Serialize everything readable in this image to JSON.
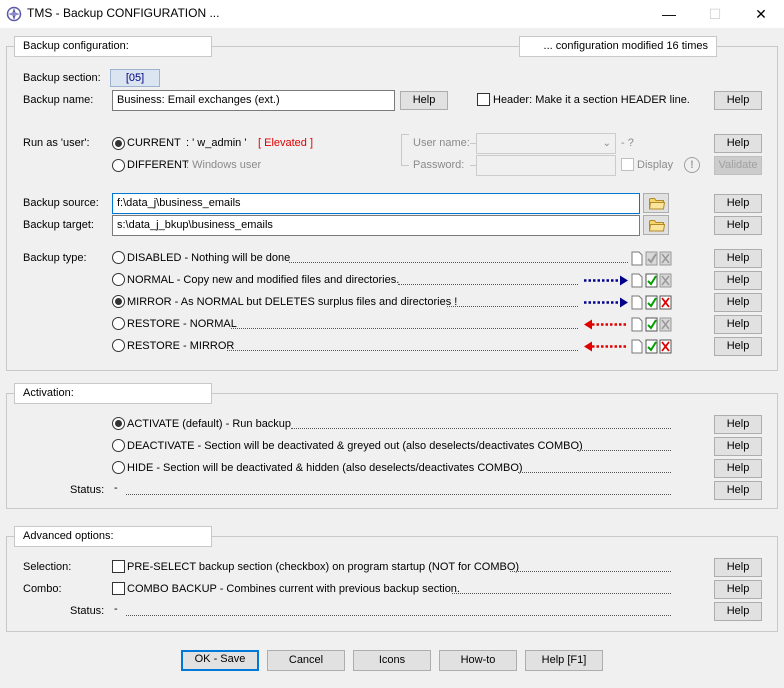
{
  "window": {
    "title": "TMS - Backup CONFIGURATION ...",
    "minimize_glyph": "—",
    "maximize_glyph": "☐",
    "close_glyph": "✕"
  },
  "backup_config": {
    "group_title": "Backup configuration:",
    "modified_text": "... configuration modified 16 times",
    "section_label": "Backup section:",
    "section_value": "[05]",
    "name_label": "Backup name:",
    "name_value": "Business: Email exchanges (ext.)",
    "header_checkbox_label": "Header: Make it a section HEADER line.",
    "run_as_label": "Run as 'user':",
    "current_label": "CURRENT",
    "current_user": ": ' w_admin '",
    "elevated": "[ Elevated ]",
    "different_label": "DIFFERENT",
    "windows_user": ": Windows user",
    "username_label": "User name:",
    "username_hint": "- ?",
    "password_label": "Password:",
    "display_label": "Display",
    "info_glyph": "!",
    "validate_label": "Validate",
    "source_label": "Backup source:",
    "source_value": "f:\\data_j\\business_emails",
    "target_label": "Backup target:",
    "target_value": "s:\\data_j_bkup\\business_emails",
    "type_label": "Backup type:",
    "types": [
      {
        "label": "DISABLED - Nothing will be done",
        "selected": false
      },
      {
        "label": "NORMAL - Copy new and modified files and directories.",
        "selected": false
      },
      {
        "label": "MIRROR - As NORMAL but DELETES surplus files and directories !",
        "selected": true
      },
      {
        "label": "RESTORE - NORMAL",
        "selected": false
      },
      {
        "label": "RESTORE - MIRROR",
        "selected": false
      }
    ]
  },
  "activation": {
    "group_title": "Activation:",
    "options": [
      {
        "label": "ACTIVATE (default) - Run backup",
        "selected": true
      },
      {
        "label": "DEACTIVATE - Section will be deactivated & greyed out (also deselects/deactivates COMBO)",
        "selected": false
      },
      {
        "label": "HIDE - Section will be deactivated & hidden (also deselects/deactivates COMBO)",
        "selected": false
      }
    ],
    "status_label": "Status:",
    "status_value": "-"
  },
  "advanced": {
    "group_title": "Advanced options:",
    "selection_label": "Selection:",
    "selection_text": "PRE-SELECT backup section (checkbox) on program startup (NOT for COMBO)",
    "combo_label": "Combo:",
    "combo_text": "COMBO BACKUP - Combines current with previous backup section.",
    "status_label": "Status:",
    "status_value": "-"
  },
  "help_label": "Help",
  "footer": {
    "ok": "OK - Save",
    "cancel": "Cancel",
    "icons": "Icons",
    "howto": "How-to",
    "help": "Help [F1]"
  },
  "colors": {
    "arrow_forward": "#00008b",
    "arrow_back": "#e00000",
    "check_green": "#00a000",
    "delete_red": "#e00000",
    "focus_blue": "#0078d7"
  }
}
